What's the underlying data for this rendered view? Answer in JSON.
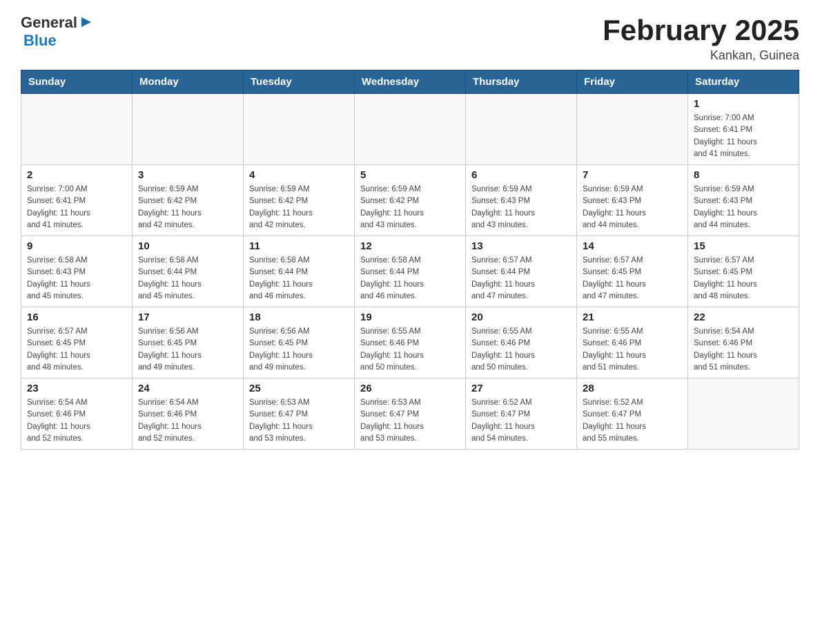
{
  "header": {
    "logo": {
      "general": "General",
      "blue": "Blue"
    },
    "title": "February 2025",
    "subtitle": "Kankan, Guinea"
  },
  "weekdays": [
    "Sunday",
    "Monday",
    "Tuesday",
    "Wednesday",
    "Thursday",
    "Friday",
    "Saturday"
  ],
  "weeks": [
    [
      {
        "day": "",
        "info": ""
      },
      {
        "day": "",
        "info": ""
      },
      {
        "day": "",
        "info": ""
      },
      {
        "day": "",
        "info": ""
      },
      {
        "day": "",
        "info": ""
      },
      {
        "day": "",
        "info": ""
      },
      {
        "day": "1",
        "info": "Sunrise: 7:00 AM\nSunset: 6:41 PM\nDaylight: 11 hours\nand 41 minutes."
      }
    ],
    [
      {
        "day": "2",
        "info": "Sunrise: 7:00 AM\nSunset: 6:41 PM\nDaylight: 11 hours\nand 41 minutes."
      },
      {
        "day": "3",
        "info": "Sunrise: 6:59 AM\nSunset: 6:42 PM\nDaylight: 11 hours\nand 42 minutes."
      },
      {
        "day": "4",
        "info": "Sunrise: 6:59 AM\nSunset: 6:42 PM\nDaylight: 11 hours\nand 42 minutes."
      },
      {
        "day": "5",
        "info": "Sunrise: 6:59 AM\nSunset: 6:42 PM\nDaylight: 11 hours\nand 43 minutes."
      },
      {
        "day": "6",
        "info": "Sunrise: 6:59 AM\nSunset: 6:43 PM\nDaylight: 11 hours\nand 43 minutes."
      },
      {
        "day": "7",
        "info": "Sunrise: 6:59 AM\nSunset: 6:43 PM\nDaylight: 11 hours\nand 44 minutes."
      },
      {
        "day": "8",
        "info": "Sunrise: 6:59 AM\nSunset: 6:43 PM\nDaylight: 11 hours\nand 44 minutes."
      }
    ],
    [
      {
        "day": "9",
        "info": "Sunrise: 6:58 AM\nSunset: 6:43 PM\nDaylight: 11 hours\nand 45 minutes."
      },
      {
        "day": "10",
        "info": "Sunrise: 6:58 AM\nSunset: 6:44 PM\nDaylight: 11 hours\nand 45 minutes."
      },
      {
        "day": "11",
        "info": "Sunrise: 6:58 AM\nSunset: 6:44 PM\nDaylight: 11 hours\nand 46 minutes."
      },
      {
        "day": "12",
        "info": "Sunrise: 6:58 AM\nSunset: 6:44 PM\nDaylight: 11 hours\nand 46 minutes."
      },
      {
        "day": "13",
        "info": "Sunrise: 6:57 AM\nSunset: 6:44 PM\nDaylight: 11 hours\nand 47 minutes."
      },
      {
        "day": "14",
        "info": "Sunrise: 6:57 AM\nSunset: 6:45 PM\nDaylight: 11 hours\nand 47 minutes."
      },
      {
        "day": "15",
        "info": "Sunrise: 6:57 AM\nSunset: 6:45 PM\nDaylight: 11 hours\nand 48 minutes."
      }
    ],
    [
      {
        "day": "16",
        "info": "Sunrise: 6:57 AM\nSunset: 6:45 PM\nDaylight: 11 hours\nand 48 minutes."
      },
      {
        "day": "17",
        "info": "Sunrise: 6:56 AM\nSunset: 6:45 PM\nDaylight: 11 hours\nand 49 minutes."
      },
      {
        "day": "18",
        "info": "Sunrise: 6:56 AM\nSunset: 6:45 PM\nDaylight: 11 hours\nand 49 minutes."
      },
      {
        "day": "19",
        "info": "Sunrise: 6:55 AM\nSunset: 6:46 PM\nDaylight: 11 hours\nand 50 minutes."
      },
      {
        "day": "20",
        "info": "Sunrise: 6:55 AM\nSunset: 6:46 PM\nDaylight: 11 hours\nand 50 minutes."
      },
      {
        "day": "21",
        "info": "Sunrise: 6:55 AM\nSunset: 6:46 PM\nDaylight: 11 hours\nand 51 minutes."
      },
      {
        "day": "22",
        "info": "Sunrise: 6:54 AM\nSunset: 6:46 PM\nDaylight: 11 hours\nand 51 minutes."
      }
    ],
    [
      {
        "day": "23",
        "info": "Sunrise: 6:54 AM\nSunset: 6:46 PM\nDaylight: 11 hours\nand 52 minutes."
      },
      {
        "day": "24",
        "info": "Sunrise: 6:54 AM\nSunset: 6:46 PM\nDaylight: 11 hours\nand 52 minutes."
      },
      {
        "day": "25",
        "info": "Sunrise: 6:53 AM\nSunset: 6:47 PM\nDaylight: 11 hours\nand 53 minutes."
      },
      {
        "day": "26",
        "info": "Sunrise: 6:53 AM\nSunset: 6:47 PM\nDaylight: 11 hours\nand 53 minutes."
      },
      {
        "day": "27",
        "info": "Sunrise: 6:52 AM\nSunset: 6:47 PM\nDaylight: 11 hours\nand 54 minutes."
      },
      {
        "day": "28",
        "info": "Sunrise: 6:52 AM\nSunset: 6:47 PM\nDaylight: 11 hours\nand 55 minutes."
      },
      {
        "day": "",
        "info": ""
      }
    ]
  ]
}
